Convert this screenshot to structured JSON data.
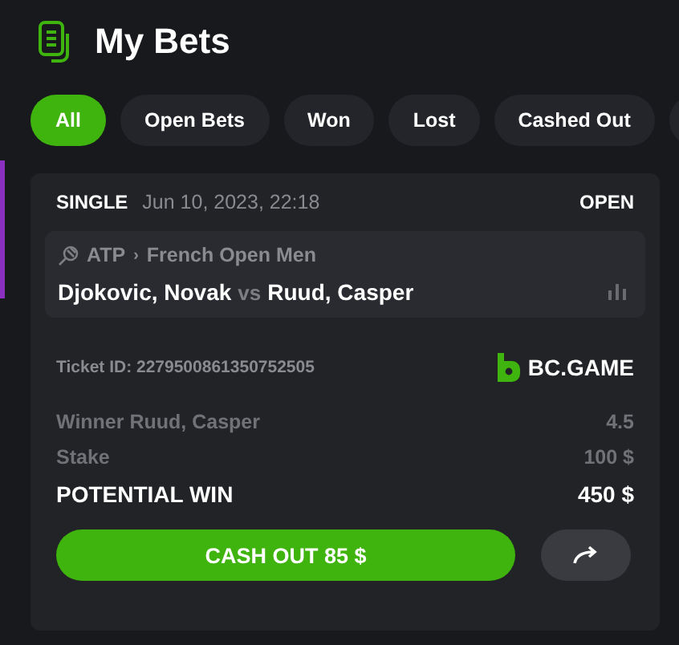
{
  "header": {
    "title": "My Bets"
  },
  "filters": [
    {
      "label": "All",
      "selected": true
    },
    {
      "label": "Open Bets",
      "selected": false
    },
    {
      "label": "Won",
      "selected": false
    },
    {
      "label": "Lost",
      "selected": false
    },
    {
      "label": "Cashed Out",
      "selected": false
    }
  ],
  "bet": {
    "type": "SINGLE",
    "date": "Jun 10, 2023, 22:18",
    "status": "OPEN",
    "event": {
      "league": "ATP",
      "separator": "›",
      "tournament": "French Open Men",
      "home": "Djokovic, Novak",
      "vs": "vs",
      "away": "Ruud, Casper"
    },
    "ticket_id": "Ticket ID: 2279500861350752505",
    "brand": "BC.GAME",
    "rows": [
      {
        "label": "Winner Ruud, Casper",
        "value": "4.5",
        "kind": "muted"
      },
      {
        "label": "Stake",
        "value": "100 $",
        "kind": "muted"
      },
      {
        "label": "POTENTIAL WIN",
        "value": "450 $",
        "kind": "total"
      }
    ],
    "cash_out": "CASH OUT 85 $"
  }
}
